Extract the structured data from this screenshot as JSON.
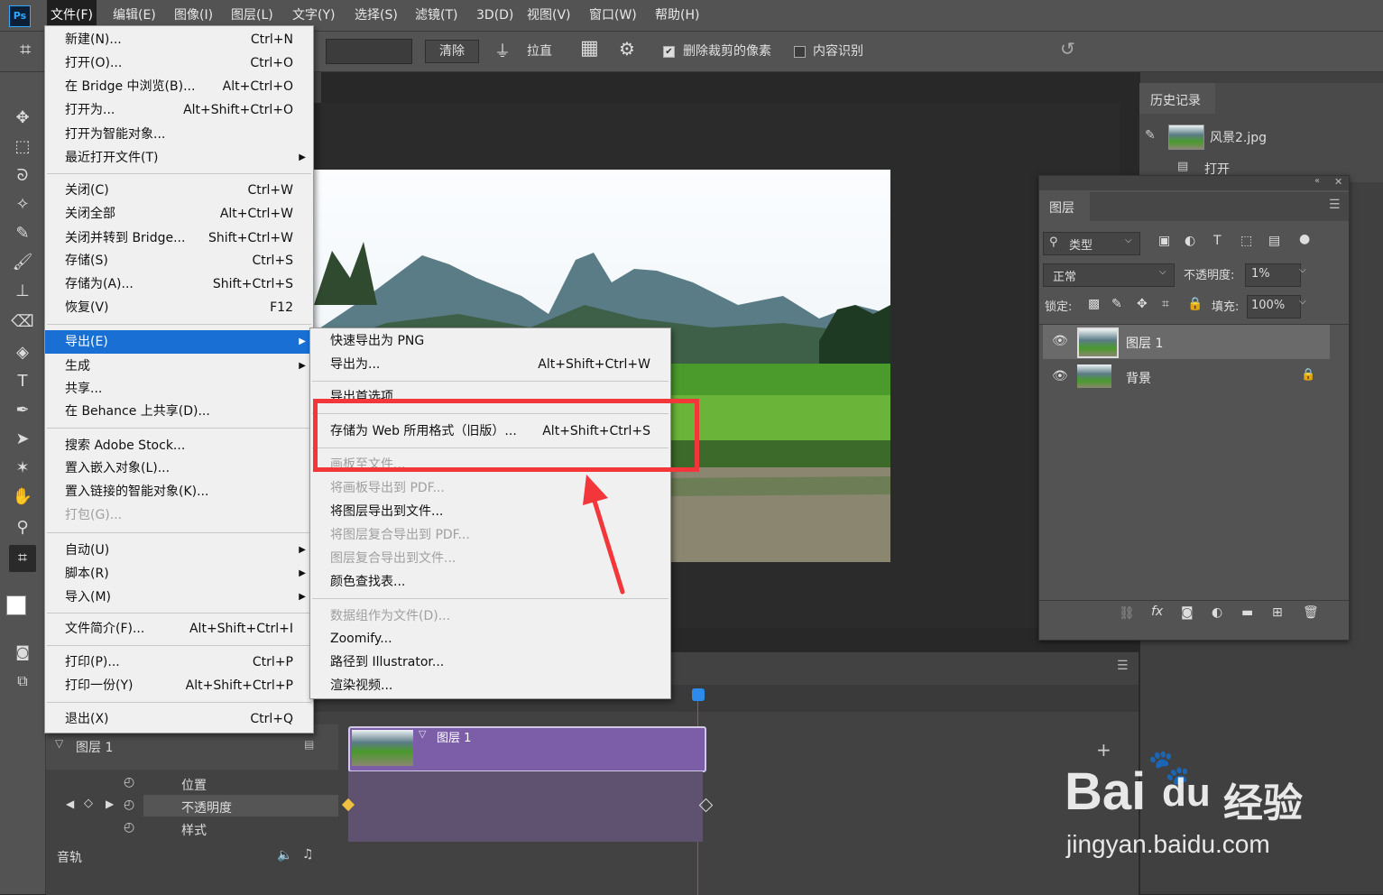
{
  "menubar": {
    "logo": "Ps",
    "items": [
      "文件(F)",
      "编辑(E)",
      "图像(I)",
      "图层(L)",
      "文字(Y)",
      "选择(S)",
      "滤镜(T)",
      "3D(D)",
      "视图(V)",
      "窗口(W)",
      "帮助(H)"
    ]
  },
  "options": {
    "clear_label": "清除",
    "straighten_label": "拉直",
    "delete_cropped_label": "删除裁剪的像素",
    "delete_cropped_checked": true,
    "content_aware_label": "内容识别",
    "content_aware_checked": false
  },
  "file_menu": {
    "items": [
      {
        "label": "新建(N)...",
        "shortcut": "Ctrl+N"
      },
      {
        "label": "打开(O)...",
        "shortcut": "Ctrl+O"
      },
      {
        "label": "在 Bridge 中浏览(B)...",
        "shortcut": "Alt+Ctrl+O"
      },
      {
        "label": "打开为...",
        "shortcut": "Alt+Shift+Ctrl+O"
      },
      {
        "label": "打开为智能对象...",
        "shortcut": ""
      },
      {
        "label": "最近打开文件(T)",
        "shortcut": ""
      },
      {
        "label": "关闭(C)",
        "shortcut": "Ctrl+W"
      },
      {
        "label": "关闭全部",
        "shortcut": "Alt+Ctrl+W"
      },
      {
        "label": "关闭并转到 Bridge...",
        "shortcut": "Shift+Ctrl+W"
      },
      {
        "label": "存储(S)",
        "shortcut": "Ctrl+S"
      },
      {
        "label": "存储为(A)...",
        "shortcut": "Shift+Ctrl+S"
      },
      {
        "label": "恢复(V)",
        "shortcut": "F12"
      },
      {
        "label": "导出(E)",
        "shortcut": ""
      },
      {
        "label": "生成",
        "shortcut": ""
      },
      {
        "label": "共享...",
        "shortcut": ""
      },
      {
        "label": "在 Behance 上共享(D)...",
        "shortcut": ""
      },
      {
        "label": "搜索 Adobe Stock...",
        "shortcut": ""
      },
      {
        "label": "置入嵌入对象(L)...",
        "shortcut": ""
      },
      {
        "label": "置入链接的智能对象(K)...",
        "shortcut": ""
      },
      {
        "label": "打包(G)...",
        "shortcut": ""
      },
      {
        "label": "自动(U)",
        "shortcut": ""
      },
      {
        "label": "脚本(R)",
        "shortcut": ""
      },
      {
        "label": "导入(M)",
        "shortcut": ""
      },
      {
        "label": "文件简介(F)...",
        "shortcut": "Alt+Shift+Ctrl+I"
      },
      {
        "label": "打印(P)...",
        "shortcut": "Ctrl+P"
      },
      {
        "label": "打印一份(Y)",
        "shortcut": "Alt+Shift+Ctrl+P"
      },
      {
        "label": "退出(X)",
        "shortcut": "Ctrl+Q"
      }
    ]
  },
  "export_menu": {
    "items": [
      {
        "label": "快速导出为 PNG",
        "shortcut": ""
      },
      {
        "label": "导出为...",
        "shortcut": "Alt+Shift+Ctrl+W"
      },
      {
        "label": "导出首选项...",
        "shortcut": ""
      },
      {
        "label": "存储为 Web 所用格式（旧版）...",
        "shortcut": "Alt+Shift+Ctrl+S"
      },
      {
        "label": "画板至文件...",
        "shortcut": ""
      },
      {
        "label": "将画板导出到 PDF...",
        "shortcut": ""
      },
      {
        "label": "将图层导出到文件...",
        "shortcut": ""
      },
      {
        "label": "将图层复合导出到 PDF...",
        "shortcut": ""
      },
      {
        "label": "图层复合导出到文件...",
        "shortcut": ""
      },
      {
        "label": "颜色查找表...",
        "shortcut": ""
      },
      {
        "label": "数据组作为文件(D)...",
        "shortcut": ""
      },
      {
        "label": "Zoomify...",
        "shortcut": ""
      },
      {
        "label": "路径到 Illustrator...",
        "shortcut": ""
      },
      {
        "label": "渲染视频...",
        "shortcut": ""
      }
    ]
  },
  "history": {
    "tab": "历史记录",
    "items": [
      "风景2.jpg",
      "打开"
    ]
  },
  "layers": {
    "tab": "图层",
    "filter_label": "类型",
    "blend_mode": "正常",
    "opacity_label": "不透明度:",
    "opacity_value": "1%",
    "lock_label": "锁定:",
    "fill_label": "填充:",
    "fill_value": "100%",
    "rows": [
      {
        "name": "图层 1"
      },
      {
        "name": "背景"
      }
    ]
  },
  "timeline": {
    "track_name": "图层 1",
    "clip_name": "图层 1",
    "props": [
      "位置",
      "不透明度",
      "样式"
    ],
    "audio_label": "音轨"
  },
  "watermark": {
    "brand": "Bai",
    "brand2": "du",
    "cn": "经验",
    "url": "jingyan.baidu.com"
  },
  "colors": {
    "accent": "#1a6fd4",
    "highlight_box": "#f2363a",
    "clip_purple": "#7b5ea7"
  }
}
